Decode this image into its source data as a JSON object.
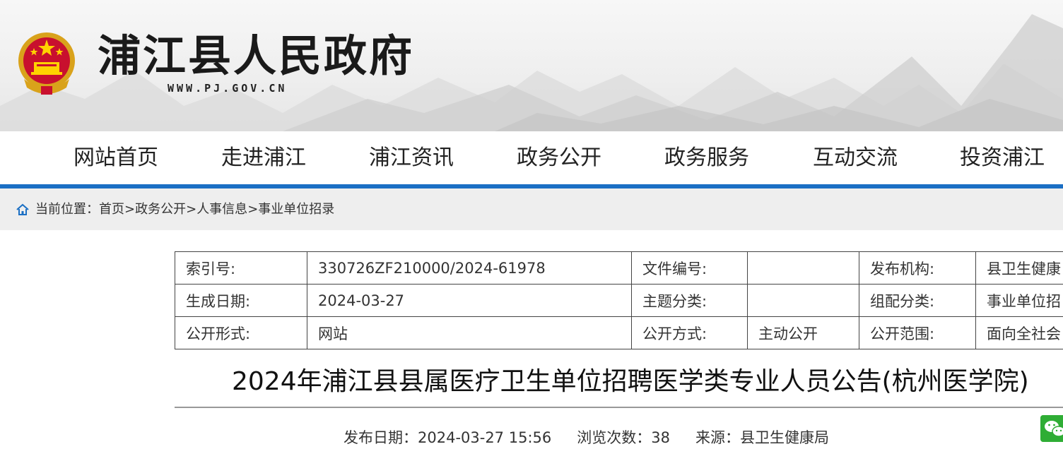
{
  "site": {
    "title": "浦江县人民政府",
    "url": "WWW.PJ.GOV.CN",
    "accent_color": "#1b6fc4"
  },
  "nav": {
    "items": [
      "网站首页",
      "走进浦江",
      "浦江资讯",
      "政务公开",
      "政务服务",
      "互动交流",
      "投资浦江"
    ]
  },
  "breadcrumb": {
    "label": "当前位置：",
    "path": [
      "首页",
      "政务公开",
      "人事信息",
      "事业单位招录"
    ],
    "separator": ">"
  },
  "meta": {
    "rows": [
      [
        {
          "label": "索引号:",
          "value": "330726ZF210000/2024-61978"
        },
        {
          "label": "文件编号:",
          "value": ""
        },
        {
          "label": "发布机构:",
          "value": "县卫生健康"
        }
      ],
      [
        {
          "label": "生成日期:",
          "value": "2024-03-27"
        },
        {
          "label": "主题分类:",
          "value": ""
        },
        {
          "label": "组配分类:",
          "value": "事业单位招"
        }
      ],
      [
        {
          "label": "公开形式:",
          "value": "网站"
        },
        {
          "label": "公开方式:",
          "value": "主动公开"
        },
        {
          "label": "公开范围:",
          "value": "面向全社会"
        }
      ]
    ]
  },
  "article": {
    "title": "2024年浦江县县属医疗卫生单位招聘医学类专业人员公告(杭州医学院)",
    "publish_label": "发布日期：",
    "publish_date": "2024-03-27 15:56",
    "views_label": "浏览次数：",
    "views": "38",
    "source_label": "来源：",
    "source": "县卫生健康局"
  },
  "icons": {
    "emblem": "national-emblem-icon",
    "home": "home-icon",
    "share": "wechat-icon"
  }
}
